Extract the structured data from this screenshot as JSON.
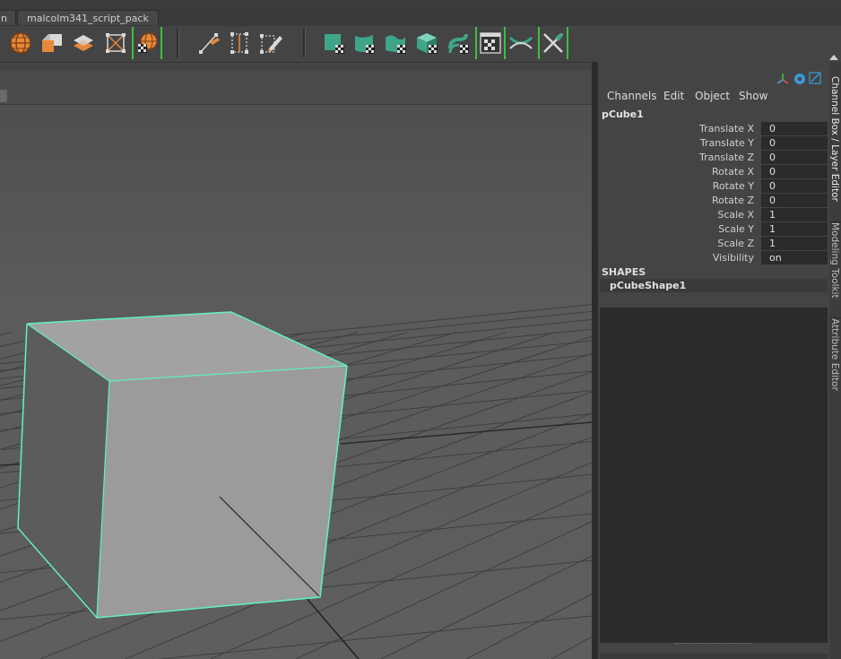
{
  "shelf_tabs": [
    "n",
    "malcolm341_script_pack"
  ],
  "shelf_tools": [
    {
      "icon": "wire-sphere-icon"
    },
    {
      "icon": "cube-shade-icon"
    },
    {
      "icon": "layered-planes-icon"
    },
    {
      "icon": "bounding-box-icon"
    },
    {
      "icon": "grid-sphere-icon",
      "highlight": true
    },
    {
      "icon": "edge-knife-icon"
    },
    {
      "icon": "dotted-frame-icon"
    },
    {
      "icon": "pen-frame-icon"
    },
    {
      "icon": "teal-cube-checker-icon"
    },
    {
      "icon": "teal-bevel-checker-icon"
    },
    {
      "icon": "teal-wave-checker-icon"
    },
    {
      "icon": "teal-cube-3d-icon"
    },
    {
      "icon": "teal-curve-arrow-icon"
    },
    {
      "icon": "checker-window-icon",
      "highlight": true
    },
    {
      "icon": "teal-x-wave-icon"
    },
    {
      "icon": "sword-cross-icon",
      "highlight": true
    }
  ],
  "channel_box": {
    "menu": [
      "Channels",
      "Edit",
      "Object",
      "Show"
    ],
    "object_name": "pCube1",
    "channels": [
      {
        "label": "Translate X",
        "value": "0"
      },
      {
        "label": "Translate Y",
        "value": "0"
      },
      {
        "label": "Translate Z",
        "value": "0"
      },
      {
        "label": "Rotate X",
        "value": "0"
      },
      {
        "label": "Rotate Y",
        "value": "0"
      },
      {
        "label": "Rotate Z",
        "value": "0"
      },
      {
        "label": "Scale X",
        "value": "1"
      },
      {
        "label": "Scale Y",
        "value": "1"
      },
      {
        "label": "Scale Z",
        "value": "1"
      },
      {
        "label": "Visibility",
        "value": "on"
      }
    ],
    "shapes_header": "SHAPES",
    "shape_name": "pCubeShape1"
  },
  "side_tabs": [
    "Channel Box / Layer Editor",
    "Modeling Toolkit",
    "Attribute Editor"
  ],
  "colors": {
    "selection_outline": "#5ff2c0",
    "shelf_highlight": "#3fbf3f",
    "accent_teal": "#3fa58a",
    "icon_orange": "#e6893a"
  }
}
